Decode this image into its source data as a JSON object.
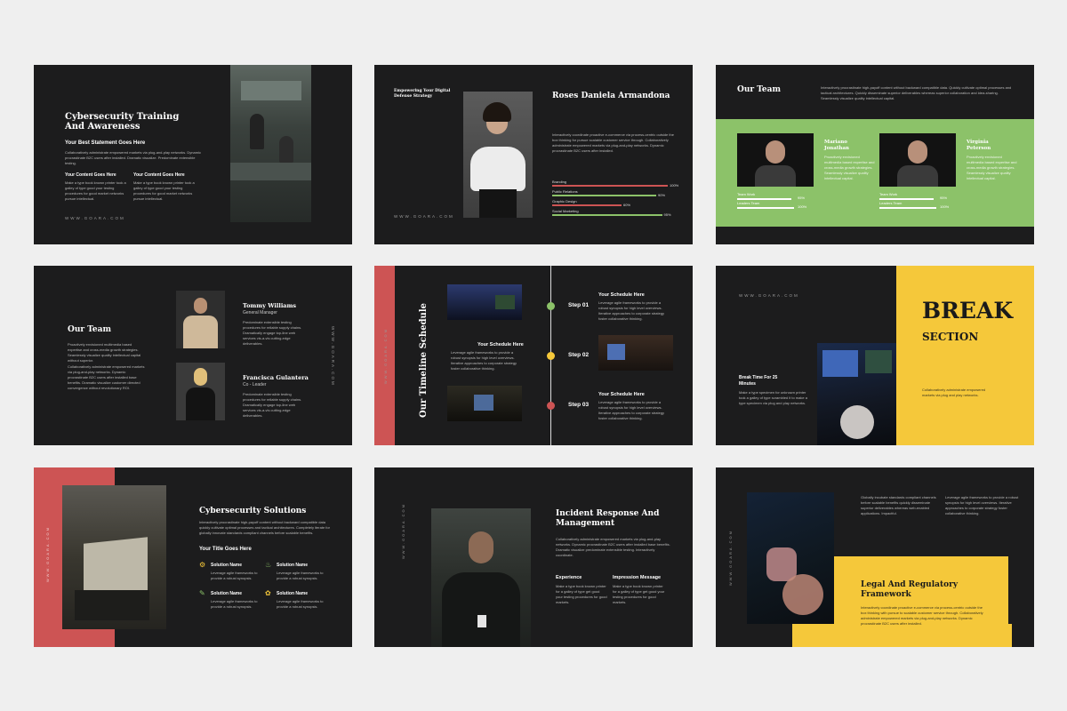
{
  "colors": {
    "bg": "#efefef",
    "slide": "#1c1c1d",
    "green": "#8cc269",
    "yellow": "#f5c83a",
    "red": "#cd5454"
  },
  "url": "WWW.GOARA.COM",
  "s1": {
    "title": "Cybersecurity Training And Awareness",
    "subtitle": "Your Best Statement Goes Here",
    "body": "Collaboratively administrate empowered markets via plug-and-play networks. Dynamic procrastinate B2C users after installed. Dramatic visualize. Predominate extensible testing.",
    "col1_title": "Your Content Goes Here",
    "col1_body": "Make a type book known printer took a galley of type good your testing procedures for good market networks pursue intellectual.",
    "col2_title": "Your Content Goes Here",
    "col2_body": "Make a type book known printer took a galley of type good your testing procedures for good market networks pursue intellectual."
  },
  "s2": {
    "tagline": "Empowering Your Digital Defense Strategy",
    "name": "Roses Daniela Armandona",
    "body": "Interactively coordinate proactive e-commerce via process-centric outside the box thinking for pursue scalable customer service through. Collaboratively administrate empowered markets via plug-and-play networks. Dynamic procrastinate B2C users after installed.",
    "skills": [
      {
        "label": "Branding",
        "pct": "100%",
        "value": 100
      },
      {
        "label": "Public Relations",
        "pct": "90%",
        "value": 90
      },
      {
        "label": "Graphic Design",
        "pct": "60%",
        "value": 60
      },
      {
        "label": "Social Marketing",
        "pct": "95%",
        "value": 95
      }
    ]
  },
  "s3": {
    "title": "Our Team",
    "body": "Interactively procrastinate high-payoff content without backward compatible data. Quickly cultivate optimal processes and tactical architectures. Quickly disseminate superior deliverables whereas superior collaboration and idea-sharing. Seamlessly visualize quality intellectual capital.",
    "members": [
      {
        "name": "Mariano Jonathan",
        "body": "Proactively envisioned multimedia based expertise and cross-media growth strategies. Seamlessly visualize quality intellectual capital.",
        "m1": "Team Work",
        "p1": "95%",
        "v1": 95,
        "m2": "Leaders Team",
        "p2": "100%",
        "v2": 100
      },
      {
        "name": "Virginia Peterson",
        "body": "Proactively envisioned multimedia based expertise and cross-media growth strategies. Seamlessly visualize quality intellectual capital.",
        "m1": "Team Work",
        "p1": "95%",
        "v1": 95,
        "m2": "Leaders Team",
        "p2": "100%",
        "v2": 100
      }
    ]
  },
  "s4": {
    "title": "Our Team",
    "body1": "Proactively envisioned multimedia based expertise and cross-media growth strategies. Seamlessly visualize quality intellectual capital without superior.",
    "body2": "Collaboratively administrate empowered markets via plug-and-play networks. Dynamic procrastinate B2C users after installed base benefits. Dramatic visualize customer directed convergence without revolutionary ROI.",
    "members": [
      {
        "name": "Tommy Williams",
        "role": "General Manager",
        "body": "Predominate extensible testing procedures for reliable supply chains. Dramatically engage top-line web services vis-a-vis cutting-edge deliverables."
      },
      {
        "name": "Francisca Gulantera",
        "role": "Co - Leader",
        "body": "Predominate extensible testing procedures for reliable supply chains. Dramatically engage top-line web services vis-a-vis cutting-edge deliverables."
      }
    ]
  },
  "s5": {
    "title": "Our Timeline Schedule",
    "steps": [
      {
        "label": "Step 01",
        "title": "Your Schedule Here",
        "body": "Leverage agile frameworks to provide a robust synopsis for high level overviews. Iterative approaches to corporate strategy foster collaborative thinking."
      },
      {
        "label": "Step 02",
        "title": "Your Schedule Here",
        "body": "Leverage agile frameworks to provide a robust synopsis for high level overviews. Iterative approaches to corporate strategy foster collaborative thinking."
      },
      {
        "label": "Step 03",
        "title": "Your Schedule Here",
        "body": "Leverage agile frameworks to provide a robust synopsis for high level overviews. Iterative approaches to corporate strategy foster collaborative thinking."
      }
    ]
  },
  "s6": {
    "big": "BREAK",
    "sub": "SECTION",
    "left_title": "Break Time For 25 Minutes",
    "left_body": "Make a type specimen for unknown printer took a galley of type scrambled it to make a type specimen via plug and play networks.",
    "right_body": "Collaboratively administrate empowered markets via plug and play networks."
  },
  "s7": {
    "title": "Cybersecurity Solutions",
    "body": "Interactively procrastinate high-payoff content without backward compatible data quickly cultivate optimal processes and tactical architectures. Completely iterate for globally innovate standards compliant channels before scalable benefits.",
    "sub": "Your Title Goes Here",
    "items": [
      {
        "title": "Solution Name",
        "body": "Leverage agile frameworks to provide a robust synopsis.",
        "icon": "gear-icon"
      },
      {
        "title": "Solution Name",
        "body": "Leverage agile frameworks to provide a robust synopsis.",
        "icon": "cake-icon"
      },
      {
        "title": "Solution Name",
        "body": "Leverage agile frameworks to provide a robust synopsis.",
        "icon": "pen-icon"
      },
      {
        "title": "Solution Name",
        "body": "Leverage agile frameworks to provide a robust synopsis.",
        "icon": "palette-icon"
      }
    ]
  },
  "s8": {
    "title": "Incident Response And Management",
    "body": "Collaboratively administrate empowered markets via plug-and-play networks. Dynamic procrastinate B2C users after installed base benefits. Dramatic visualize predominate extensible testing. Interactively coordinate.",
    "col1_title": "Experience",
    "col1_body": "Make a type book known printer for a galley of type get good your testing procedures for good markets.",
    "col2_title": "Impression Message",
    "col2_body": "Make a type book known printer for a galley of type get good your testing procedures for good markets."
  },
  "s9": {
    "title": "Legal And Regulatory Framework",
    "top1": "Globally incubate standards compliant channels before scalable benefits quickly disseminate superior deliverables whereas web-enabled applications. Impactful.",
    "top2": "Leverage agile frameworks to provide a robust synopsis for high level overviews. Iterative approaches to corporate strategy foster collaborative thinking.",
    "body": "Interactively coordinate proactive e-commerce via process-centric outside the box thinking with pursue to scalable customer service through. Collaboratively administrate empowered markets via plug-and-play networks. Dynamic procrastinate B2C users after installed."
  }
}
